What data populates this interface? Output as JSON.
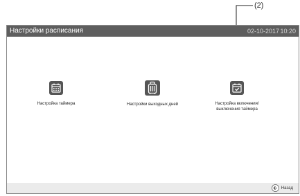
{
  "callout": {
    "label": "(2)"
  },
  "header": {
    "title": "Настройки расписания",
    "date": "02-10-2017",
    "time": "10:20"
  },
  "tiles": [
    {
      "label": "Настройка таймера",
      "icon": "calendar-grid-icon"
    },
    {
      "label": "Настройки выходных дней",
      "icon": "suitcase-icon"
    },
    {
      "label_line1": "Настройка включения/",
      "label_line2": "выключения таймера",
      "icon": "calendar-check-icon"
    }
  ],
  "footer": {
    "back_label": "Назад",
    "back_icon": "back-arrow-icon"
  },
  "colors": {
    "titlebar": "#5e5e5e",
    "icon_bg": "#555555",
    "footer": "#ebebeb"
  }
}
